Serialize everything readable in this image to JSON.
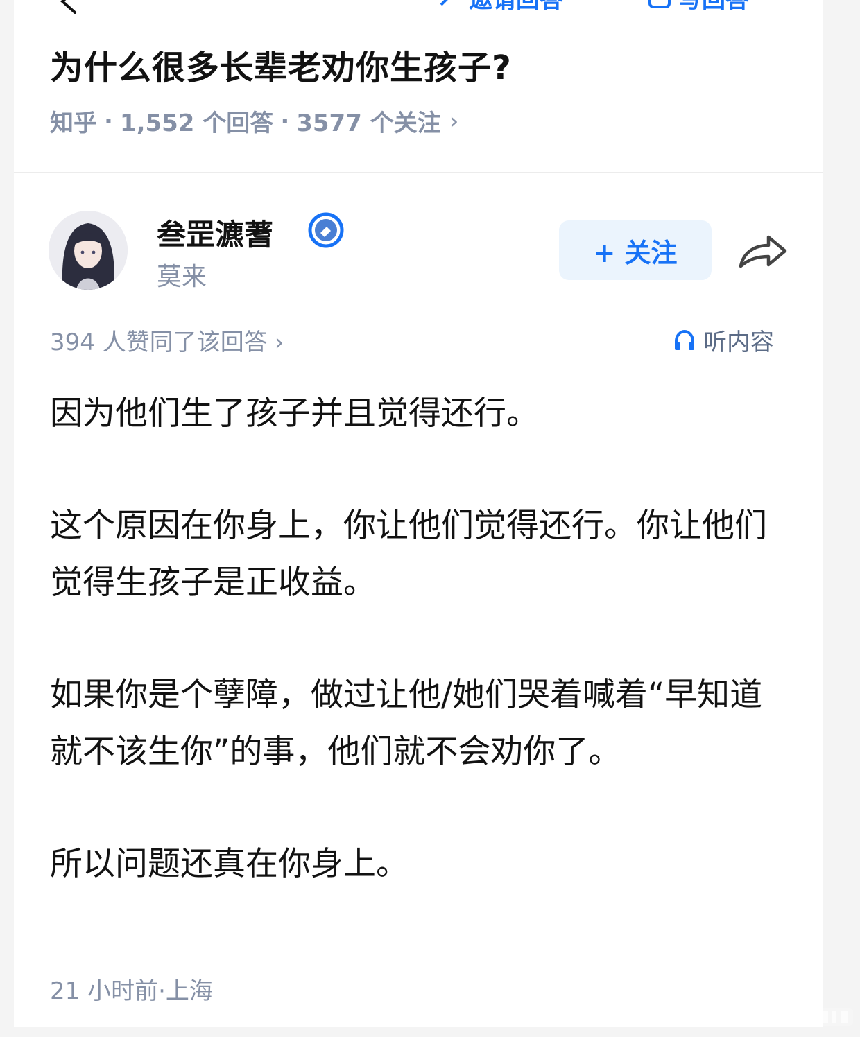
{
  "toolbar": {
    "invite_label": "邀请回答",
    "write_label": "写回答"
  },
  "question": {
    "title": "为什么很多长辈老劝你生孩子?",
    "source": "知乎",
    "separator": "·",
    "answers": "1,552 个回答",
    "followers": "3577 个关注",
    "chevron": "›"
  },
  "author": {
    "name": "叁罡瀌蓍",
    "bio": "莫来",
    "badge_icon": "verified-badge-icon",
    "follow_label": "+ 关注"
  },
  "stats": {
    "upvotes": "394 人赞同了该回答",
    "chevron": "›",
    "listen_label": "听内容"
  },
  "answer": {
    "paragraphs": [
      "因为他们生了孩子并且觉得还行。",
      "这个原因在你身上，你让他们觉得还行。你让他们觉得生孩子是正收益。",
      "如果你是个孽障，做过让他/她们哭着喊着“早知道就不该生你”的事，他们就不会劝你了。",
      "所以问题还真在你身上。"
    ],
    "time": "21 小时前",
    "location_sep": "·",
    "location": "上海"
  },
  "colors": {
    "accent": "#1772f6",
    "meta": "#8590a6",
    "text": "#121212",
    "follow_bg": "#ebf4fd"
  }
}
